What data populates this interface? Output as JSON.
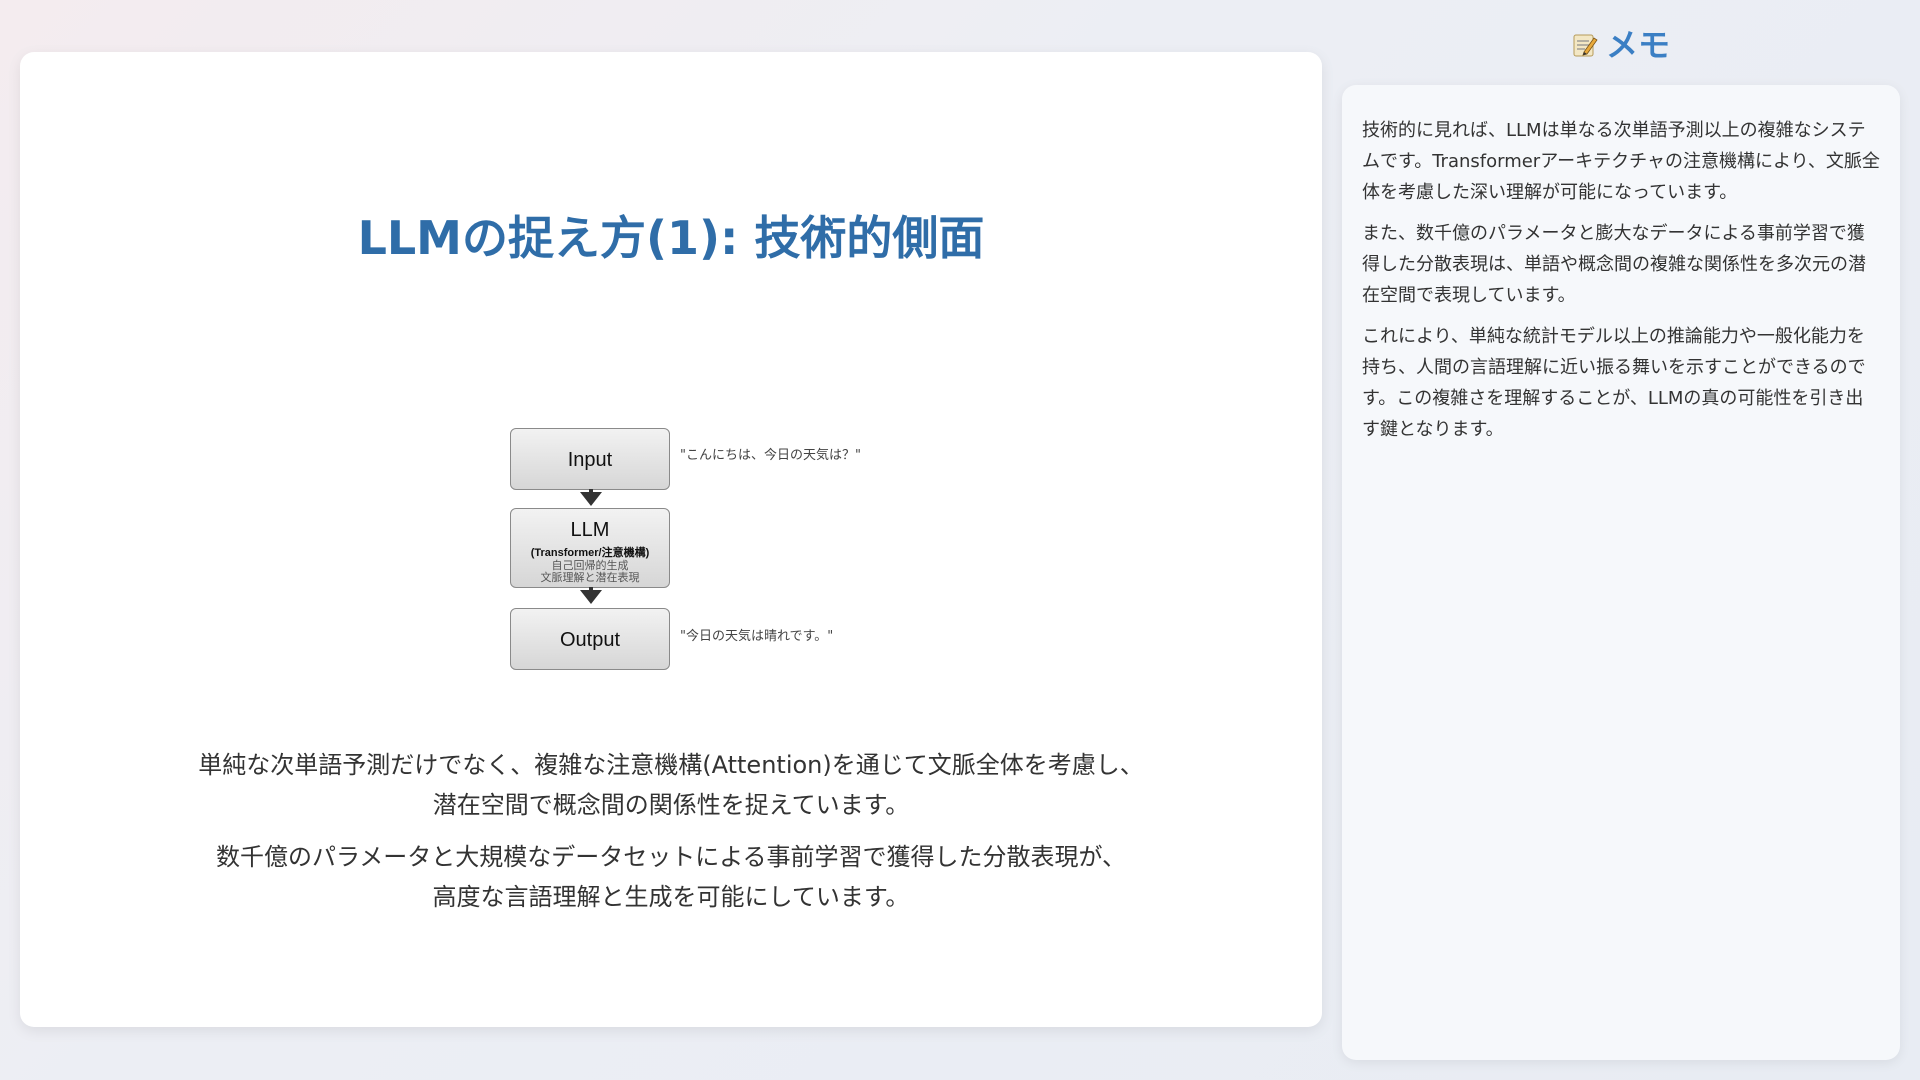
{
  "slide": {
    "title": "LLMの捉え方(1): 技術的側面",
    "diagram": {
      "input_label": "Input",
      "input_quote": "\"こんにちは、今日の天気は？\"",
      "llm_label": "LLM",
      "llm_sub": "(Transformer/注意機構)",
      "llm_note_1": "自己回帰的生成",
      "llm_note_2": "文脈理解と潜在表現",
      "output_label": "Output",
      "output_quote": "\"今日の天気は晴れです。\""
    },
    "paragraphs": [
      {
        "line1": "単純な次単語予測だけでなく、複雑な注意機構(Attention)を通じて文脈全体を考慮し、",
        "line2": "潜在空間で概念間の関係性を捉えています。"
      },
      {
        "line1": "数千億のパラメータと大規模なデータセットによる事前学習で獲得した分散表現が、",
        "line2": "高度な言語理解と生成を可能にしています。"
      }
    ]
  },
  "memo": {
    "title": "メモ",
    "icon": "memo-pencil-icon",
    "paragraphs": [
      "技術的に見れば、LLMは単なる次単語予測以上の複雑なシステムです。Transformerアーキテクチャの注意機構により、文脈全体を考慮した深い理解が可能になっています。",
      "また、数千億のパラメータと膨大なデータによる事前学習で獲得した分散表現は、単語や概念間の複雑な関係性を多次元の潜在空間で表現しています。",
      "これにより、単純な統計モデル以上の推論能力や一般化能力を持ち、人間の言語理解に近い振る舞いを示すことができるのです。この複雑さを理解することが、LLMの真の可能性を引き出す鍵となります。"
    ]
  },
  "colors": {
    "title": "#2f6da8",
    "memo_title": "#3b7fc4"
  }
}
